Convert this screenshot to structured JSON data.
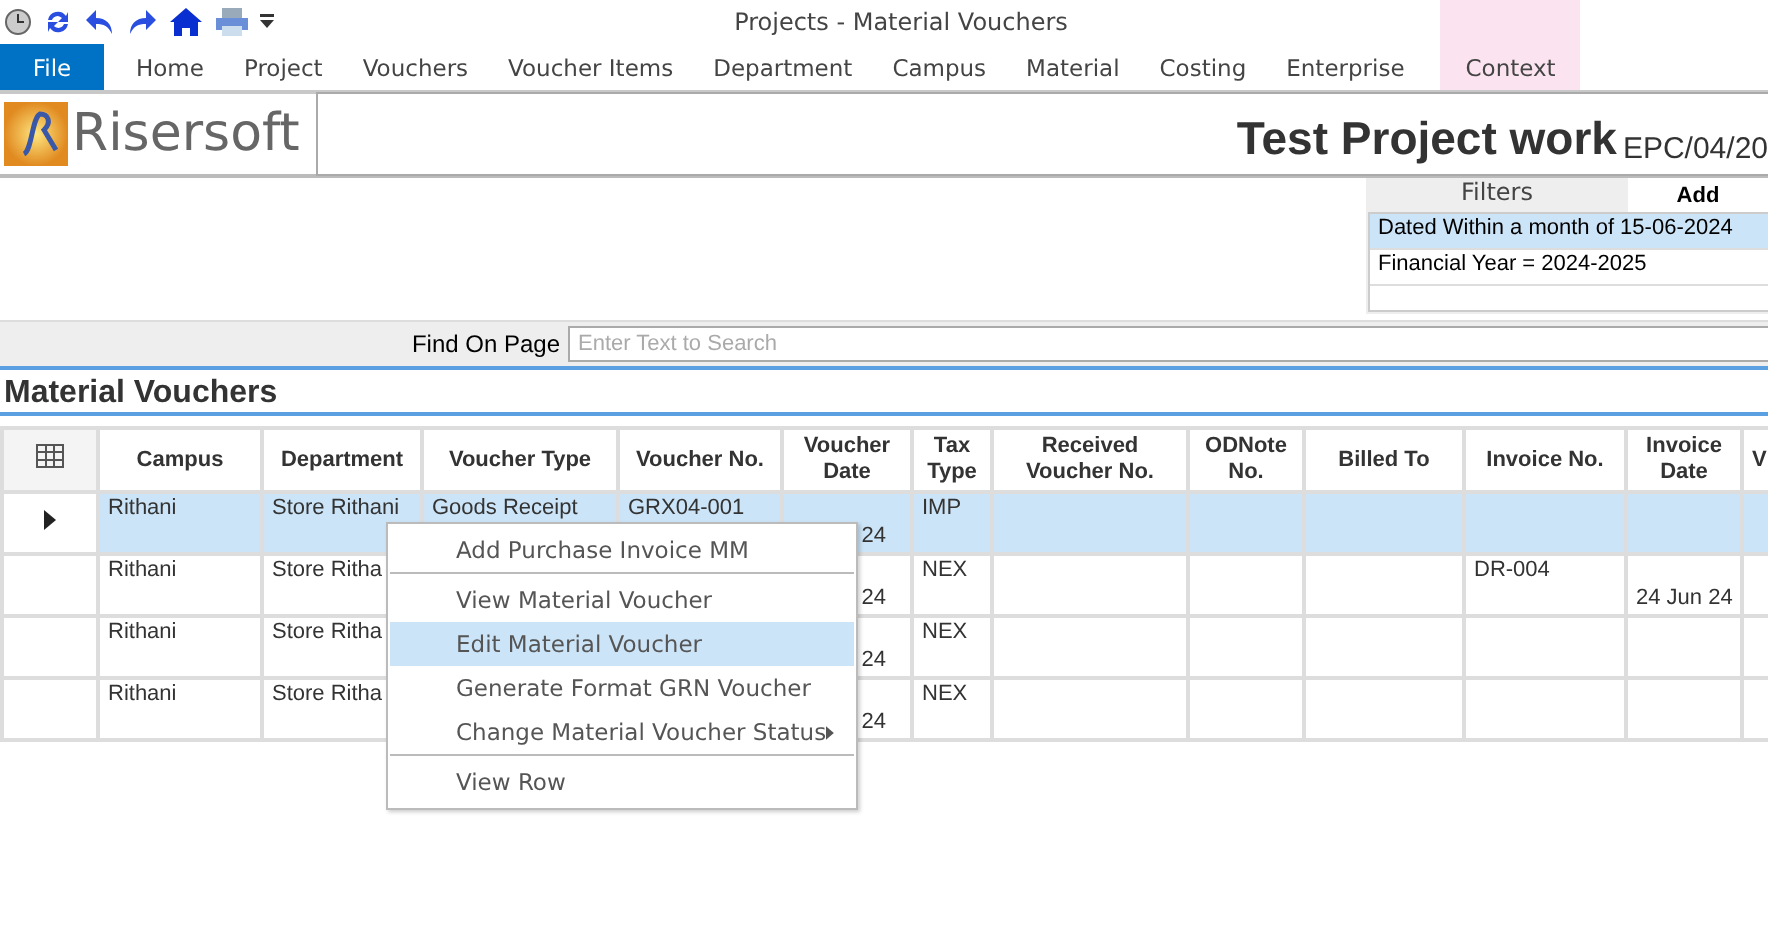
{
  "window": {
    "title": "Projects - Material Vouchers"
  },
  "ribbon_tabs": [
    {
      "label": "File",
      "kind": "file"
    },
    {
      "label": "Home",
      "kind": "normal"
    },
    {
      "label": "Project",
      "kind": "normal"
    },
    {
      "label": "Vouchers",
      "kind": "normal"
    },
    {
      "label": "Voucher Items",
      "kind": "normal"
    },
    {
      "label": "Department",
      "kind": "normal"
    },
    {
      "label": "Campus",
      "kind": "normal"
    },
    {
      "label": "Material",
      "kind": "normal"
    },
    {
      "label": "Costing",
      "kind": "normal"
    },
    {
      "label": "Enterprise",
      "kind": "normal"
    },
    {
      "label": "Context",
      "kind": "context"
    }
  ],
  "brand": {
    "name": "Risersoft"
  },
  "project": {
    "title": "Test Project work",
    "code": "EPC/04/20"
  },
  "filters": {
    "title": "Filters",
    "add": "Add",
    "items": [
      {
        "label": "Dated Within a month of 15-06-2024",
        "selected": true
      },
      {
        "label": "Financial Year = 2024-2025",
        "selected": false
      }
    ]
  },
  "find": {
    "label": "Find On Page",
    "placeholder": "Enter Text to Search"
  },
  "section_title": "Material Vouchers",
  "table": {
    "columns": [
      "Campus",
      "Department",
      "Voucher Type",
      "Voucher No.",
      "Voucher Date",
      "Tax Type",
      "Received Voucher No.",
      "ODNote No.",
      "Billed To",
      "Invoice No.",
      "Invoice Date",
      "V"
    ],
    "rows": [
      {
        "selected": true,
        "cells": [
          "Rithani",
          "Store Rithani",
          "Goods Receipt",
          "GRX04-001",
          "24",
          "IMP",
          "",
          "",
          "",
          "",
          "",
          ""
        ]
      },
      {
        "selected": false,
        "cells": [
          "Rithani",
          "Store Ritha",
          "",
          "",
          "24",
          "NEX",
          "",
          "",
          "",
          "DR-004",
          "24 Jun 24",
          ""
        ]
      },
      {
        "selected": false,
        "cells": [
          "Rithani",
          "Store Ritha",
          "",
          "",
          "24",
          "NEX",
          "",
          "",
          "",
          "",
          "",
          ""
        ]
      },
      {
        "selected": false,
        "cells": [
          "Rithani",
          "Store Ritha",
          "",
          "",
          "24",
          "NEX",
          "",
          "",
          "",
          "",
          "",
          ""
        ]
      }
    ]
  },
  "context_menu": [
    {
      "label": "Add Purchase Invoice MM",
      "selected": false,
      "submenu": false,
      "separator_after": true
    },
    {
      "label": "View Material Voucher",
      "selected": false,
      "submenu": false,
      "separator_after": false
    },
    {
      "label": "Edit Material Voucher",
      "selected": true,
      "submenu": false,
      "separator_after": false
    },
    {
      "label": "Generate Format GRN Voucher",
      "selected": false,
      "submenu": false,
      "separator_after": false
    },
    {
      "label": "Change Material Voucher Status",
      "selected": false,
      "submenu": true,
      "separator_after": true
    },
    {
      "label": "View Row",
      "selected": false,
      "submenu": false,
      "separator_after": false
    }
  ]
}
